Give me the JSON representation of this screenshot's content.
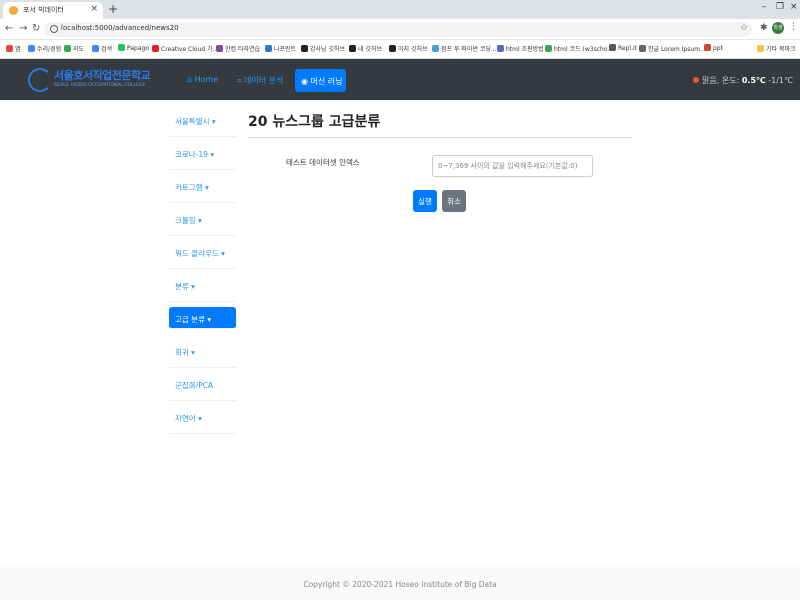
{
  "browser": {
    "tab_title": "포서 빅데이터",
    "url": "localhost:5000/advanced/news20",
    "profile_initials": "학생",
    "bookmarks": [
      {
        "label": "앱",
        "color": "#e8453c"
      },
      {
        "label": "수리/경험",
        "color": "#4285f4"
      },
      {
        "label": "지도",
        "color": "#34a853"
      },
      {
        "label": "검색",
        "color": "#4285f4"
      },
      {
        "label": "Papago",
        "color": "#21c55d"
      },
      {
        "label": "Creative Cloud 가...",
        "color": "#e3211f"
      },
      {
        "label": "한컴 타자연습",
        "color": "#7a4ea3"
      },
      {
        "label": "나프린트",
        "color": "#2d78d0"
      },
      {
        "label": "강사님 깃허브",
        "color": "#222222"
      },
      {
        "label": "내 깃허브",
        "color": "#222222"
      },
      {
        "label": "이지 깃허브",
        "color": "#222222"
      },
      {
        "label": "점프 투 파이썬 코딩...",
        "color": "#4a9fd5"
      },
      {
        "label": "html 조판방법",
        "color": "#5b6bbf"
      },
      {
        "label": "html 코드 (w3scho...",
        "color": "#3aa757"
      },
      {
        "label": "Repl.it",
        "color": "#555555"
      },
      {
        "label": "한글 Lorem Ipsum...",
        "color": "#666666"
      },
      {
        "label": "ppt",
        "color": "#d24726"
      },
      {
        "label": "기타 북마크",
        "color": "#f4c542"
      }
    ]
  },
  "navbar": {
    "logo_title": "서울호서직업전문학교",
    "logo_subtitle": "SEOUL HOSEO OCCUPATIONAL COLLEGE",
    "links": [
      {
        "label": "⌂ Home"
      },
      {
        "label": "⌗ 데이터 분석"
      }
    ],
    "active_link": "◉ 머신 러닝",
    "weather_label": "맑음, 온도:",
    "weather_value": "0.5℃",
    "weather_range": "-1/1℃"
  },
  "sidebar": {
    "items": [
      {
        "label": "서울특별시 ▾"
      },
      {
        "label": "코로나-19 ▾"
      },
      {
        "label": "카토그램 ▾"
      },
      {
        "label": "크롤링 ▾"
      },
      {
        "label": "워드 클라우드 ▾"
      },
      {
        "label": "분류 ▾"
      },
      {
        "label": "고급 분류 ▾",
        "active": true
      },
      {
        "label": "회귀 ▾"
      },
      {
        "label": "군집화/PCA"
      },
      {
        "label": "자연어 ▾"
      }
    ]
  },
  "main": {
    "title": "20 뉴스그룹 고급분류",
    "field_label": "테스트 데이터셋 인덱스",
    "field_placeholder": "0~7,369 사이의 값을 입력해주세요(기본값:0)",
    "run_label": "실행",
    "cancel_label": "취소"
  },
  "footer": {
    "text": "Copyright © 2020-2021 Hoseo Institute of Big Data"
  }
}
